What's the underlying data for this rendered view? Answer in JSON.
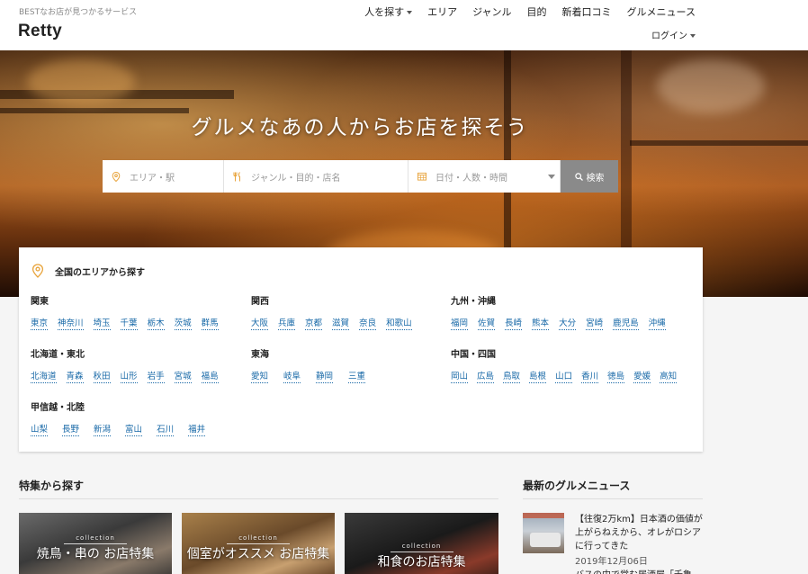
{
  "header": {
    "tagline": "BESTなお店が見つかるサービス",
    "logo": "Retty",
    "nav": [
      {
        "label": "人を探す",
        "has_caret": true
      },
      {
        "label": "エリア"
      },
      {
        "label": "ジャンル"
      },
      {
        "label": "目的"
      },
      {
        "label": "新着口コミ"
      },
      {
        "label": "グルメニュース"
      }
    ],
    "login": "ログイン"
  },
  "hero": {
    "title": "グルメなあの人からお店を探そう",
    "search": {
      "area_placeholder": "エリア・駅",
      "genre_placeholder": "ジャンル・目的・店名",
      "date_placeholder": "日付・人数・時間",
      "button": "検索"
    }
  },
  "areas": {
    "heading": "全国のエリアから探す",
    "regions": [
      {
        "name": "関東",
        "prefs": [
          "東京",
          "神奈川",
          "埼玉",
          "千葉",
          "栃木",
          "茨城",
          "群馬"
        ]
      },
      {
        "name": "関西",
        "prefs": [
          "大阪",
          "兵庫",
          "京都",
          "滋賀",
          "奈良",
          "和歌山"
        ]
      },
      {
        "name": "九州・沖縄",
        "prefs": [
          "福岡",
          "佐賀",
          "長崎",
          "熊本",
          "大分",
          "宮崎",
          "鹿児島",
          "沖縄"
        ]
      },
      {
        "name": "北海道・東北",
        "prefs": [
          "北海道",
          "青森",
          "秋田",
          "山形",
          "岩手",
          "宮城",
          "福島"
        ]
      },
      {
        "name": "東海",
        "prefs": [
          "愛知",
          "岐阜",
          "静岡",
          "三重"
        ]
      },
      {
        "name": "中国・四国",
        "prefs": [
          "岡山",
          "広島",
          "鳥取",
          "島根",
          "山口",
          "香川",
          "徳島",
          "愛媛",
          "高知"
        ]
      },
      {
        "name": "甲信越・北陸",
        "prefs": [
          "山梨",
          "長野",
          "新潟",
          "富山",
          "石川",
          "福井"
        ]
      }
    ]
  },
  "features": {
    "title": "特集から探す",
    "items": [
      {
        "collection": "collection",
        "name": "焼鳥・串の お店特集"
      },
      {
        "collection": "collection",
        "name": "個室がオススメ お店特集"
      },
      {
        "collection": "collection",
        "name": "和食のお店特集"
      }
    ]
  },
  "news": {
    "title": "最新のグルメニュース",
    "items": [
      {
        "headline": "【往復2万km】日本酒の価値が上がらねえから、オレがロシアに行ってきた",
        "date": "2019年12月06日"
      },
      {
        "headline": "バスの中で営む居酒屋「千亀"
      }
    ]
  },
  "colors": {
    "accent_icon": "#e8a33a",
    "link": "#1a6aa8",
    "search_button": "#8a8a8a"
  }
}
